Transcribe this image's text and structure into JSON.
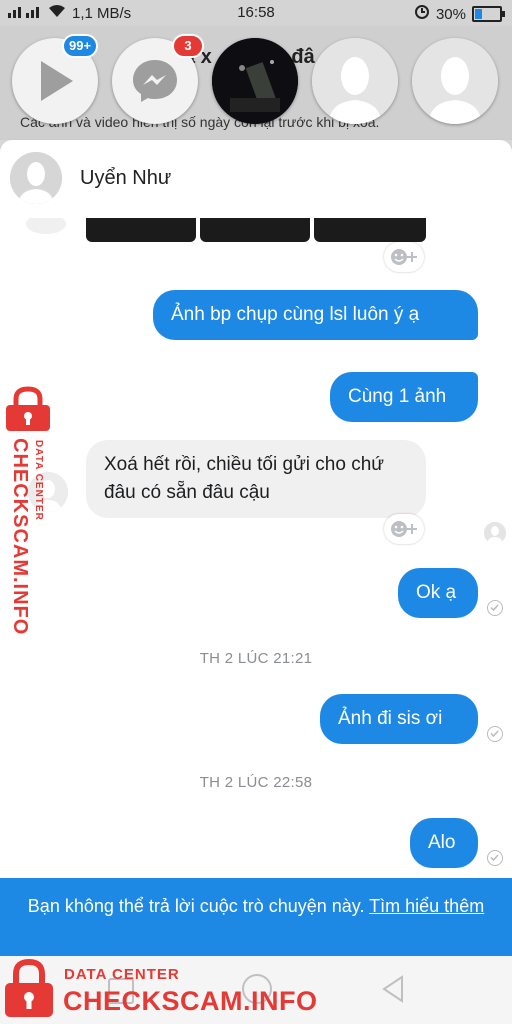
{
  "status_bar": {
    "network_speed": "1,1 MB/s",
    "time": "16:58",
    "battery": "30%",
    "battery_level": 0.3
  },
  "header": {
    "title": "ã x",
    "title_tail": "đâ",
    "subtitle": "Các ảnh và video hiển thị số ngày còn lại trước khi bị xoá."
  },
  "chat_heads": [
    {
      "name": "play-app",
      "badge": "99+"
    },
    {
      "name": "messenger-app",
      "badge": "3"
    },
    {
      "name": "photo-contact",
      "badge": ""
    },
    {
      "name": "contact",
      "badge": ""
    },
    {
      "name": "contact",
      "badge": ""
    }
  ],
  "contact": {
    "name": "Uyển Như"
  },
  "messages": [
    {
      "from": "me",
      "text": "Ảnh bp chụp cùng lsl luôn ý ạ"
    },
    {
      "from": "me",
      "text": "Cùng 1 ảnh"
    },
    {
      "from": "them",
      "text": "Xoá hết rồi, chiều tối gửi cho chứ đâu có sẵn đâu cậu"
    },
    {
      "from": "me",
      "text": "Ok ạ"
    },
    {
      "from": "me",
      "text": "Ảnh đi sis ơi"
    },
    {
      "from": "me",
      "text": "Alo"
    }
  ],
  "timestamps": [
    "TH 2 LÚC 21:21",
    "TH 2 LÚC 22:58"
  ],
  "footer": {
    "notice": "Bạn không thể trả lời cuộc trò chuyện này.",
    "link": "Tìm hiểu thêm"
  },
  "watermark": {
    "label": "DATA CENTER",
    "brand": "CHECKSCAM.INFO"
  },
  "colors": {
    "accent": "#1e88e5",
    "badge": "#e53935",
    "watermark": "#e53935"
  }
}
